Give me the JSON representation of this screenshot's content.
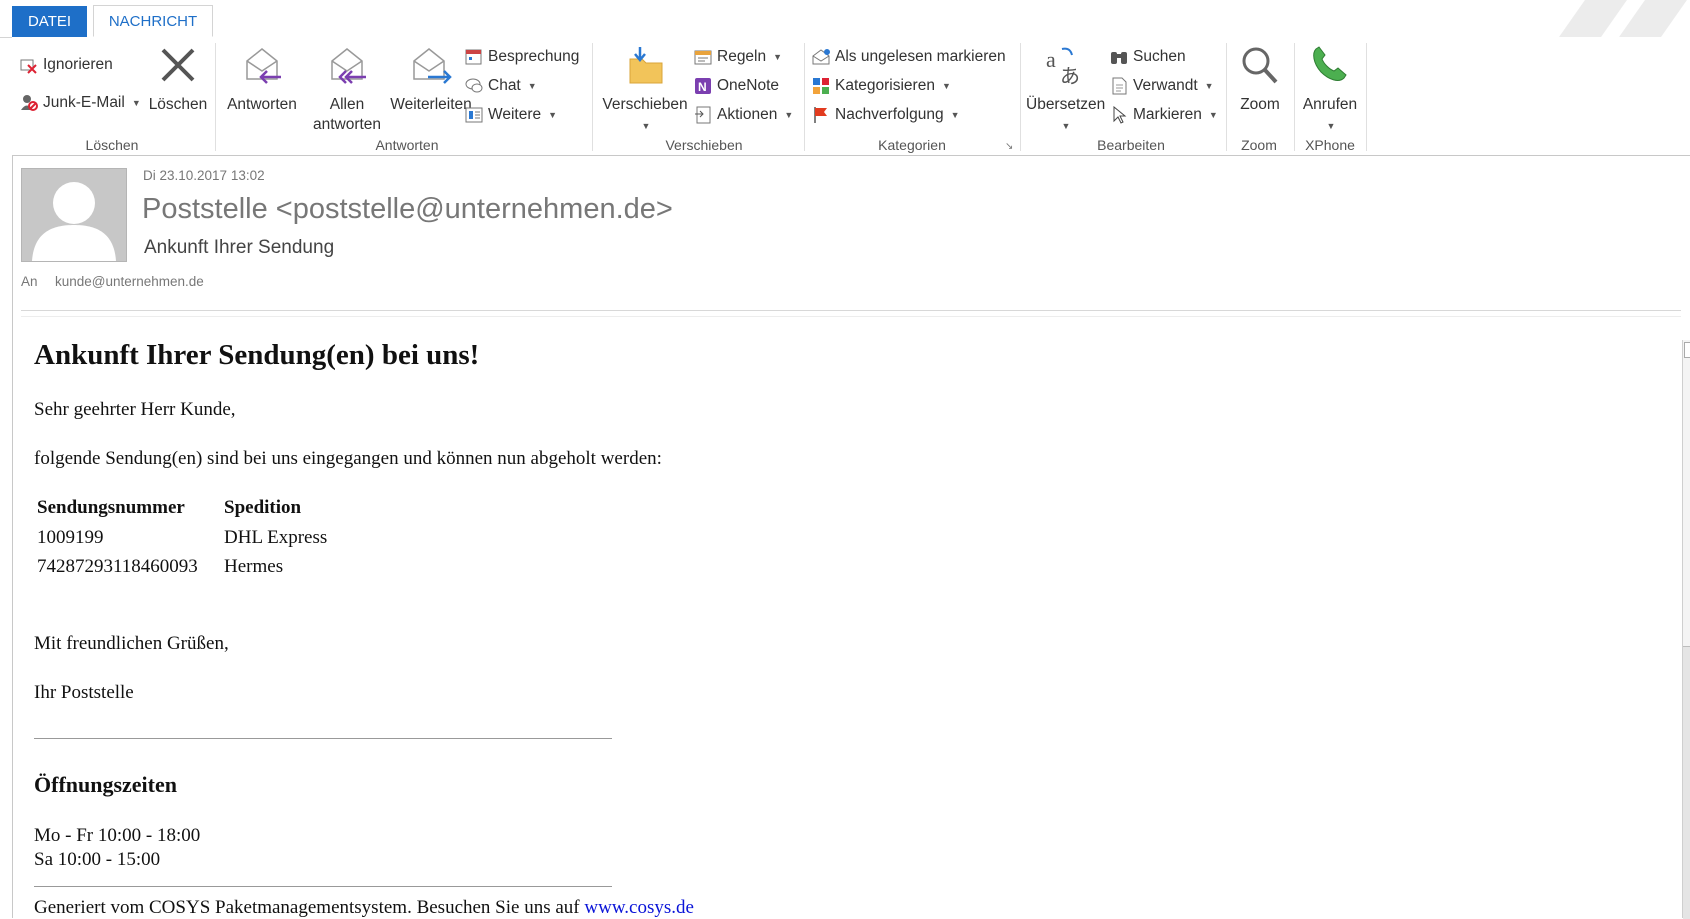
{
  "tabs": {
    "file": "DATEI",
    "message": "NACHRICHT"
  },
  "ribbon": {
    "delete_group": {
      "ignore": "Ignorieren",
      "junk": "Junk-E-Mail",
      "delete": "Löschen",
      "label": "Löschen"
    },
    "respond_group": {
      "reply": "Antworten",
      "reply_all_1": "Allen",
      "reply_all_2": "antworten",
      "forward": "Weiterleiten",
      "meeting": "Besprechung",
      "chat": "Chat",
      "more": "Weitere",
      "label": "Antworten"
    },
    "move_group": {
      "move": "Verschieben",
      "rules": "Regeln",
      "onenote": "OneNote",
      "actions": "Aktionen",
      "label": "Verschieben"
    },
    "tags_group": {
      "mark_unread": "Als ungelesen markieren",
      "categorize": "Kategorisieren",
      "follow_up": "Nachverfolgung",
      "label": "Kategorien"
    },
    "edit_group": {
      "translate": "Übersetzen",
      "find": "Suchen",
      "related": "Verwandt",
      "select": "Markieren",
      "label": "Bearbeiten"
    },
    "zoom_group": {
      "zoom": "Zoom",
      "label": "Zoom"
    },
    "xphone_group": {
      "call": "Anrufen",
      "label": "XPhone"
    }
  },
  "header": {
    "date": "Di 23.10.2017 13:02",
    "from": "Poststelle <poststelle@unternehmen.de>",
    "subject": "Ankunft Ihrer Sendung",
    "to_label": "An",
    "to": "kunde@unternehmen.de"
  },
  "body": {
    "heading": "Ankunft Ihrer Sendung(en) bei uns!",
    "greeting": "Sehr geehrter Herr Kunde,",
    "intro": "folgende Sendung(en) sind bei uns eingegangen und können nun abgeholt werden:",
    "table": {
      "headers": [
        "Sendungsnummer",
        "Spedition"
      ],
      "rows": [
        [
          "1009199",
          "DHL Express"
        ],
        [
          "74287293118460093",
          "Hermes"
        ]
      ]
    },
    "closing": "Mit freundlichen Grüßen,",
    "signature": "Ihr Poststelle",
    "hours_heading": "Öffnungszeiten",
    "hours_weekdays": "Mo - Fr 10:00 - 18:00",
    "hours_saturday": "Sa 10:00 - 15:00",
    "footer_text": "Generiert vom COSYS Paketmanagementsystem. Besuchen Sie uns auf ",
    "footer_link": "www.cosys.de"
  },
  "colors": {
    "accent": "#1e6fc8",
    "link": "#0a14d8"
  }
}
